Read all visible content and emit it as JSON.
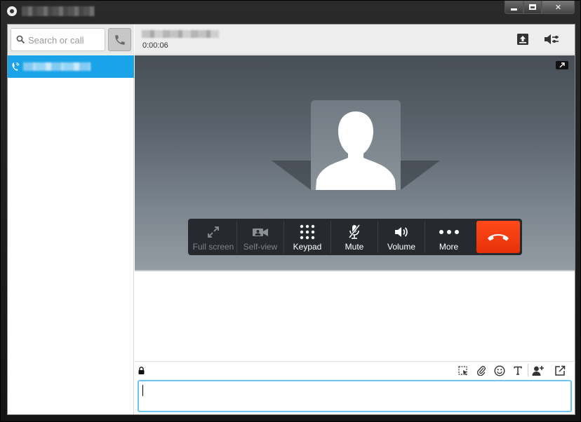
{
  "window": {
    "title": "",
    "buttons": {
      "minimize": "minimize",
      "maximize": "maximize",
      "close": "✕"
    }
  },
  "sidebar": {
    "search": {
      "placeholder": "Search or call",
      "value": ""
    },
    "contacts": [
      {
        "name": "",
        "icon": "phone-call-icon",
        "selected": true
      }
    ]
  },
  "call": {
    "caller_name": "",
    "timer": "0:00:06"
  },
  "controls": [
    {
      "id": "fullscreen",
      "label": "Full screen",
      "icon": "expand-arrows-icon",
      "enabled": false
    },
    {
      "id": "selfview",
      "label": "Self-view",
      "icon": "camera-icon",
      "enabled": false
    },
    {
      "id": "keypad",
      "label": "Keypad",
      "icon": "keypad-icon",
      "enabled": true
    },
    {
      "id": "mute",
      "label": "Mute",
      "icon": "microphone-muted-icon",
      "enabled": true
    },
    {
      "id": "volume",
      "label": "Volume",
      "icon": "speaker-icon",
      "enabled": true
    },
    {
      "id": "more",
      "label": "More",
      "icon": "ellipsis-icon",
      "enabled": true
    },
    {
      "id": "endcall",
      "label": "",
      "icon": "hang-up-icon",
      "enabled": true
    }
  ],
  "chat": {
    "message_value": "",
    "toolbar_icons": [
      "screen-capture-icon",
      "attachment-icon",
      "emoticon-icon",
      "text-format-icon",
      "add-participant-icon",
      "popout-icon"
    ]
  },
  "colors": {
    "accent": "#1aa3e8",
    "end_call": "#f0390f",
    "controls_bg": "#262a2e",
    "input_focus": "#6fc4ee"
  }
}
